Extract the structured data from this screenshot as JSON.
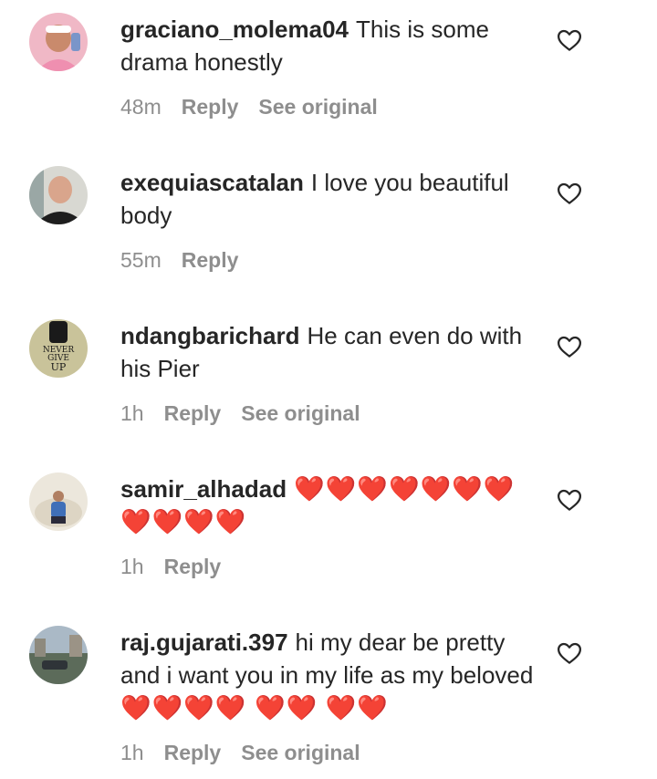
{
  "comments": [
    {
      "username": "graciano_molema04",
      "text": "This is some drama honestly",
      "time": "48m",
      "reply_label": "Reply",
      "see_original_label": "See original",
      "avatar_icon": "user-avatar-icon"
    },
    {
      "username": "exequiascatalan",
      "text": "I love you beautiful body",
      "time": "55m",
      "reply_label": "Reply",
      "avatar_icon": "user-avatar-icon"
    },
    {
      "username": "ndangbarichard",
      "text": "He can even do with his Pier",
      "time": "1h",
      "reply_label": "Reply",
      "see_original_label": "See original",
      "avatar_text": [
        "NEVER",
        "GIVE",
        "UP"
      ],
      "avatar_icon": "fist-logo-icon"
    },
    {
      "username": "samir_alhadad",
      "text": "❤️❤️❤️❤️❤️❤️❤️ ❤️❤️❤️❤️",
      "time": "1h",
      "reply_label": "Reply",
      "avatar_icon": "user-avatar-icon"
    },
    {
      "username": "raj.gujarati.397",
      "text": "hi my dear be pretty and i want you in my life as my beloved",
      "text_hearts": "❤️❤️❤️❤️ ❤️❤️ ❤️❤️",
      "time": "1h",
      "reply_label": "Reply",
      "see_original_label": "See original",
      "avatar_icon": "user-avatar-icon"
    }
  ],
  "icons": {
    "like": "heart-outline-icon"
  },
  "colors": {
    "text": "#262626",
    "meta": "#8e8e8e",
    "heart": "#e8171f"
  }
}
